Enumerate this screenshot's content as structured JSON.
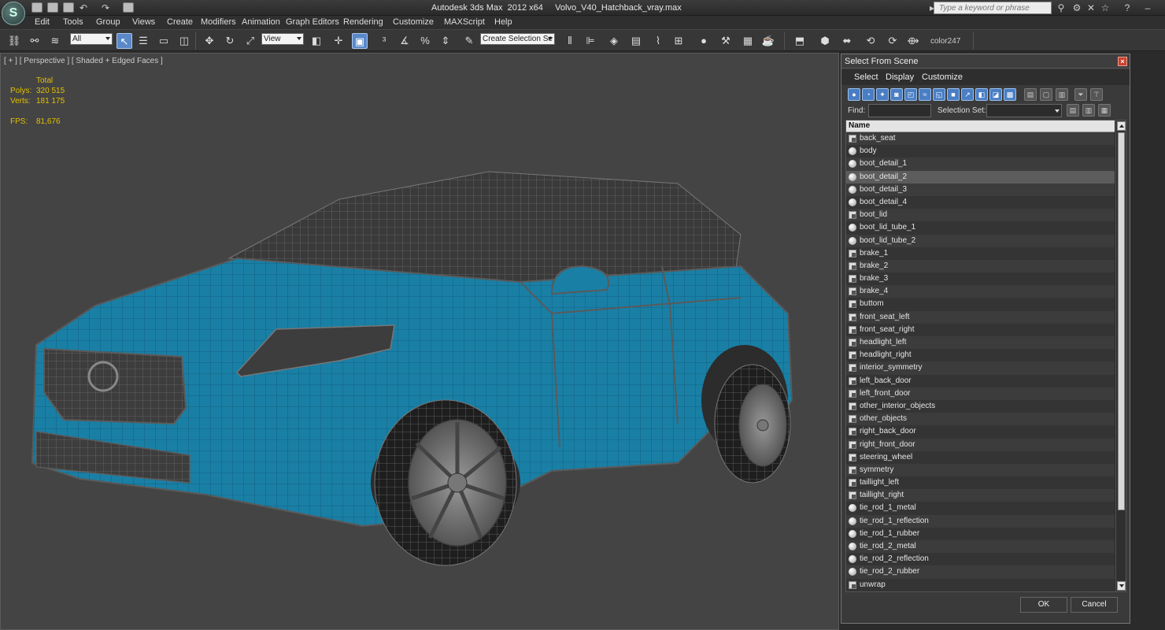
{
  "app": {
    "title": "Autodesk 3ds Max  2012 x64     Volvo_V40_Hatchback_vray.max",
    "logo": "S",
    "search_placeholder": "Type a keyword or phrase"
  },
  "menu": [
    "Edit",
    "Tools",
    "Group",
    "Views",
    "Create",
    "Modifiers",
    "Animation",
    "Graph Editors",
    "Rendering",
    "Customize",
    "MAXScript",
    "Help"
  ],
  "toolbar": {
    "filter_value": "All",
    "ref_coord_value": "View",
    "selection_set_placeholder": "Create Selection Se",
    "color_label": "color247"
  },
  "viewport": {
    "label": "[ + ] [ Perspective ] [ Shaded + Edged Faces ]",
    "stats": {
      "total_label": "Total",
      "polys_label": "Polys:",
      "polys_value": "320 515",
      "verts_label": "Verts:",
      "verts_value": "181 175",
      "fps_label": "FPS:",
      "fps_value": "81,676"
    },
    "car_color": "#1a7fa5",
    "wire_color": "#5a5a5a"
  },
  "dialog": {
    "title": "Select From Scene",
    "menu": [
      "Select",
      "Display",
      "Customize"
    ],
    "find_label": "Find:",
    "find_value": "",
    "selection_set_label": "Selection Set:",
    "column_name": "Name",
    "items": [
      {
        "name": "back_seat",
        "icon": "mesh"
      },
      {
        "name": "body",
        "icon": "sphere"
      },
      {
        "name": "boot_detail_1",
        "icon": "sphere"
      },
      {
        "name": "boot_detail_2",
        "icon": "sphere",
        "selected": true
      },
      {
        "name": "boot_detail_3",
        "icon": "sphere"
      },
      {
        "name": "boot_detail_4",
        "icon": "sphere"
      },
      {
        "name": "boot_lid",
        "icon": "mesh"
      },
      {
        "name": "boot_lid_tube_1",
        "icon": "sphere"
      },
      {
        "name": "boot_lid_tube_2",
        "icon": "sphere"
      },
      {
        "name": "brake_1",
        "icon": "mesh"
      },
      {
        "name": "brake_2",
        "icon": "mesh"
      },
      {
        "name": "brake_3",
        "icon": "mesh"
      },
      {
        "name": "brake_4",
        "icon": "mesh"
      },
      {
        "name": "buttom",
        "icon": "mesh"
      },
      {
        "name": "front_seat_left",
        "icon": "mesh"
      },
      {
        "name": "front_seat_right",
        "icon": "mesh"
      },
      {
        "name": "headlight_left",
        "icon": "mesh"
      },
      {
        "name": "headlight_right",
        "icon": "mesh"
      },
      {
        "name": "interior_symmetry",
        "icon": "mesh"
      },
      {
        "name": "left_back_door",
        "icon": "mesh"
      },
      {
        "name": "left_front_door",
        "icon": "mesh"
      },
      {
        "name": "other_interior_objects",
        "icon": "mesh"
      },
      {
        "name": "other_objects",
        "icon": "mesh"
      },
      {
        "name": "right_back_door",
        "icon": "mesh"
      },
      {
        "name": "right_front_door",
        "icon": "mesh"
      },
      {
        "name": "steering_wheel",
        "icon": "mesh"
      },
      {
        "name": "symmetry",
        "icon": "mesh"
      },
      {
        "name": "taillight_left",
        "icon": "mesh"
      },
      {
        "name": "taillight_right",
        "icon": "mesh"
      },
      {
        "name": "tie_rod_1_metal",
        "icon": "sphere"
      },
      {
        "name": "tie_rod_1_reflection",
        "icon": "sphere"
      },
      {
        "name": "tie_rod_1_rubber",
        "icon": "sphere"
      },
      {
        "name": "tie_rod_2_metal",
        "icon": "sphere"
      },
      {
        "name": "tie_rod_2_reflection",
        "icon": "sphere"
      },
      {
        "name": "tie_rod_2_rubber",
        "icon": "sphere"
      },
      {
        "name": "unwrap",
        "icon": "mesh"
      }
    ],
    "ok_label": "OK",
    "cancel_label": "Cancel"
  }
}
